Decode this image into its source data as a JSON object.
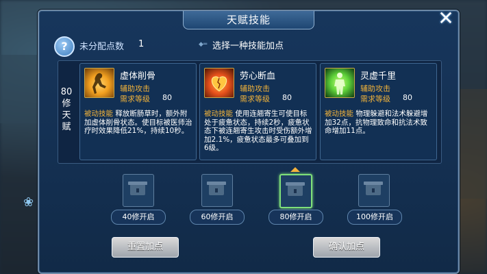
{
  "dialog": {
    "title": "天赋技能",
    "close_glyph": "✕"
  },
  "points": {
    "label": "未分配点数",
    "value": "1"
  },
  "hint": "选择一种技能加点",
  "tier": {
    "label_lines": [
      "80",
      "修",
      "天",
      "赋"
    ]
  },
  "skills": [
    {
      "name": "虚体削骨",
      "type": "辅助攻击",
      "req_label": "需求等级",
      "req_value": "80",
      "tag": "被动技能",
      "desc": "释放断肠草时，额外附加虚体削骨状态。使目标被医师治疗时效果降低21%，持续10秒。",
      "icon": "withered-body-icon",
      "icon_color": "#f2a020"
    },
    {
      "name": "劳心断血",
      "type": "辅助攻击",
      "req_label": "需求等级",
      "req_value": "80",
      "tag": "被动技能",
      "desc": "使用连翘寄生可使目标处于疲惫状态，持续2秒，疲惫状态下被连翘寄生攻击时受伤额外增加2.1%，疲惫状态最多可叠加到6级。",
      "icon": "broken-heart-icon",
      "icon_color": "#e8521c"
    },
    {
      "name": "灵虚千里",
      "type": "辅助攻击",
      "req_label": "需求等级",
      "req_value": "80",
      "tag": "被动技能",
      "desc": "物理躲避和法术躲避增加32点，抗物理致命和抗法术致命增加11点。",
      "icon": "spirit-body-icon",
      "icon_color": "#5fd23a"
    }
  ],
  "slots": [
    {
      "label": "40修开启",
      "active": false
    },
    {
      "label": "60修开启",
      "active": false
    },
    {
      "label": "80修开启",
      "active": true
    },
    {
      "label": "100修开启",
      "active": false
    }
  ],
  "buttons": {
    "reset": "重置加点",
    "confirm": "确认加点"
  }
}
